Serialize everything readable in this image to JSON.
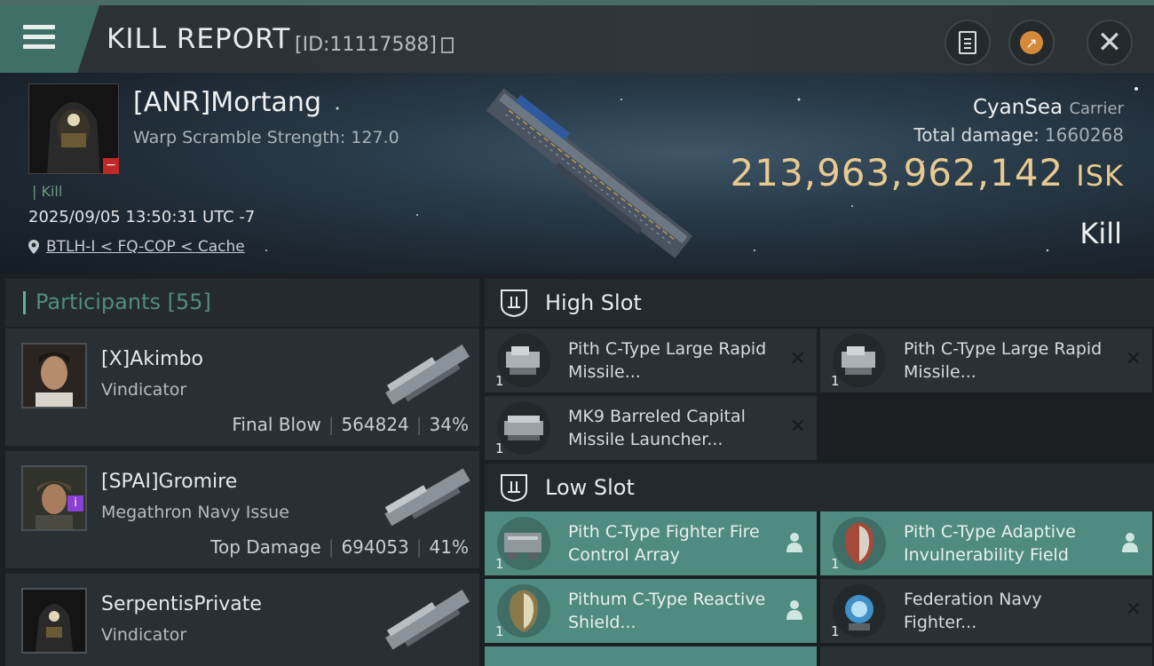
{
  "header": {
    "title": "KILL REPORT",
    "report_id": "[ID:11117588]"
  },
  "victim": {
    "name": "[ANR]Mortang",
    "warp_scramble": "Warp Scramble Strength: 127.0",
    "tag": "| Kill",
    "datetime": "2025/09/05 13:50:31 UTC -7",
    "location": "BTLH-I < FQ-COP < Cache",
    "corp": "CyanSea",
    "ship_type": "Carrier",
    "total_damage_label": "Total damage:",
    "total_damage": "1660268",
    "isk_value": "213,963,962,142",
    "isk_unit": "ISK",
    "result": "Kill"
  },
  "participants": {
    "label": "Participants",
    "count": "[55]",
    "rows": [
      {
        "name": "[X]Akimbo",
        "ship": "Vindicator",
        "role": "Final Blow",
        "damage": "564824",
        "percent": "34%"
      },
      {
        "name": "[SPAI]Gromire",
        "ship": "Megathron Navy Issue",
        "role": "Top Damage",
        "damage": "694053",
        "percent": "41%"
      },
      {
        "name": "SerpentisPrivate",
        "ship": "Vindicator",
        "role": "",
        "damage": "",
        "percent": ""
      }
    ]
  },
  "high_slot": {
    "label": "High Slot",
    "modules": [
      {
        "name": "Pith C-Type Large Rapid Missile...",
        "qty": "1",
        "status": "destroyed"
      },
      {
        "name": "Pith C-Type Large Rapid Missile...",
        "qty": "1",
        "status": "destroyed"
      },
      {
        "name": "MK9 Barreled Capital Missile Launcher...",
        "qty": "1",
        "status": "destroyed"
      }
    ]
  },
  "low_slot": {
    "label": "Low Slot",
    "modules": [
      {
        "name": "Pith C-Type Fighter Fire Control Array",
        "qty": "1",
        "status": "dropped"
      },
      {
        "name": "Pith C-Type Adaptive Invulnerability Field",
        "qty": "1",
        "status": "dropped"
      },
      {
        "name": "Pithum C-Type Reactive Shield...",
        "qty": "1",
        "status": "dropped"
      },
      {
        "name": "Federation Navy Fighter...",
        "qty": "1",
        "status": "destroyed"
      }
    ]
  },
  "icons": {
    "menu": "hamburger-icon",
    "copy": "copy-icon",
    "clipboard": "clipboard-icon",
    "share": "share-icon",
    "close": "close-icon",
    "location": "pin-icon"
  },
  "colors": {
    "accent_teal": "#4f8b81",
    "isk_gold": "#e8c98f",
    "header_teal": "#3f6f66"
  }
}
